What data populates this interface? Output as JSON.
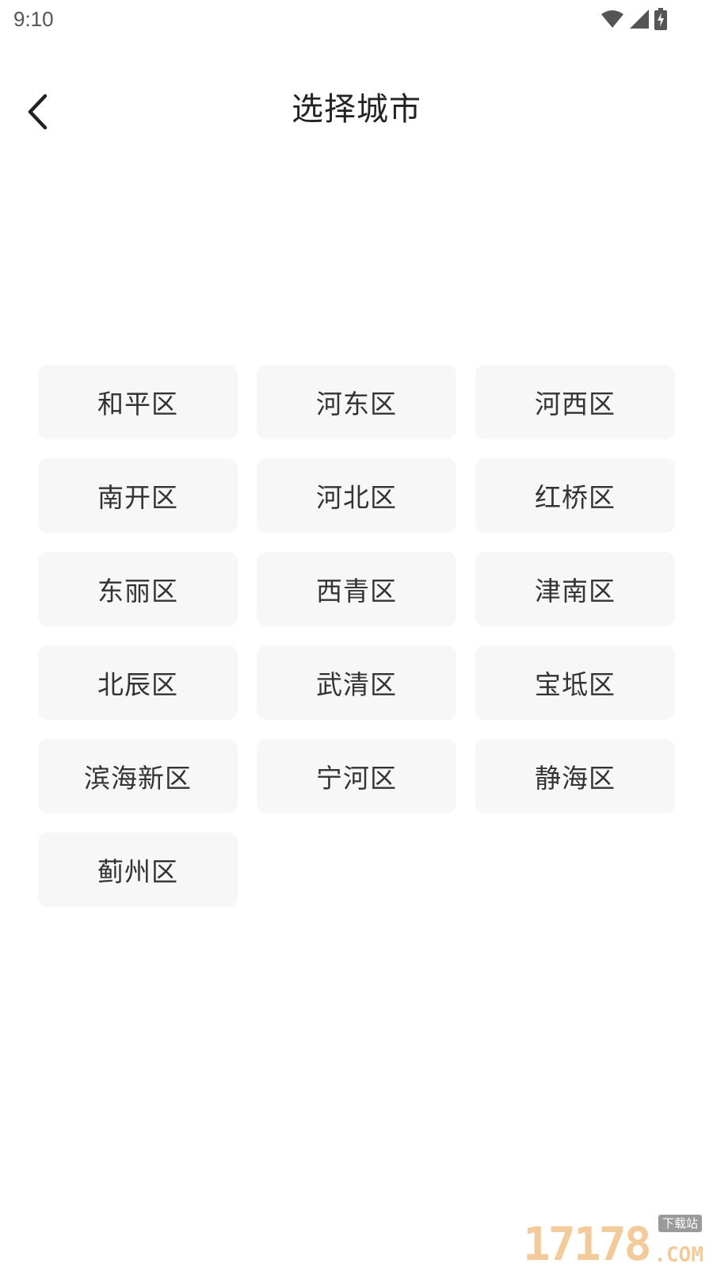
{
  "status_bar": {
    "time": "9:10",
    "icons": [
      "wifi-icon",
      "cellular-signal-icon",
      "battery-charging-icon"
    ]
  },
  "header": {
    "title": "选择城市",
    "back_icon": "chevron-left-icon"
  },
  "districts": [
    "和平区",
    "河东区",
    "河西区",
    "南开区",
    "河北区",
    "红桥区",
    "东丽区",
    "西青区",
    "津南区",
    "北辰区",
    "武清区",
    "宝坻区",
    "滨海新区",
    "宁河区",
    "静海区",
    "蓟州区"
  ],
  "watermark": {
    "digits": "17178",
    "tag": "下载站",
    "domain": ".COM"
  },
  "colors": {
    "background": "#ffffff",
    "button_background": "#f7f7f7",
    "text": "#333333",
    "watermark": "#f1c38a"
  }
}
